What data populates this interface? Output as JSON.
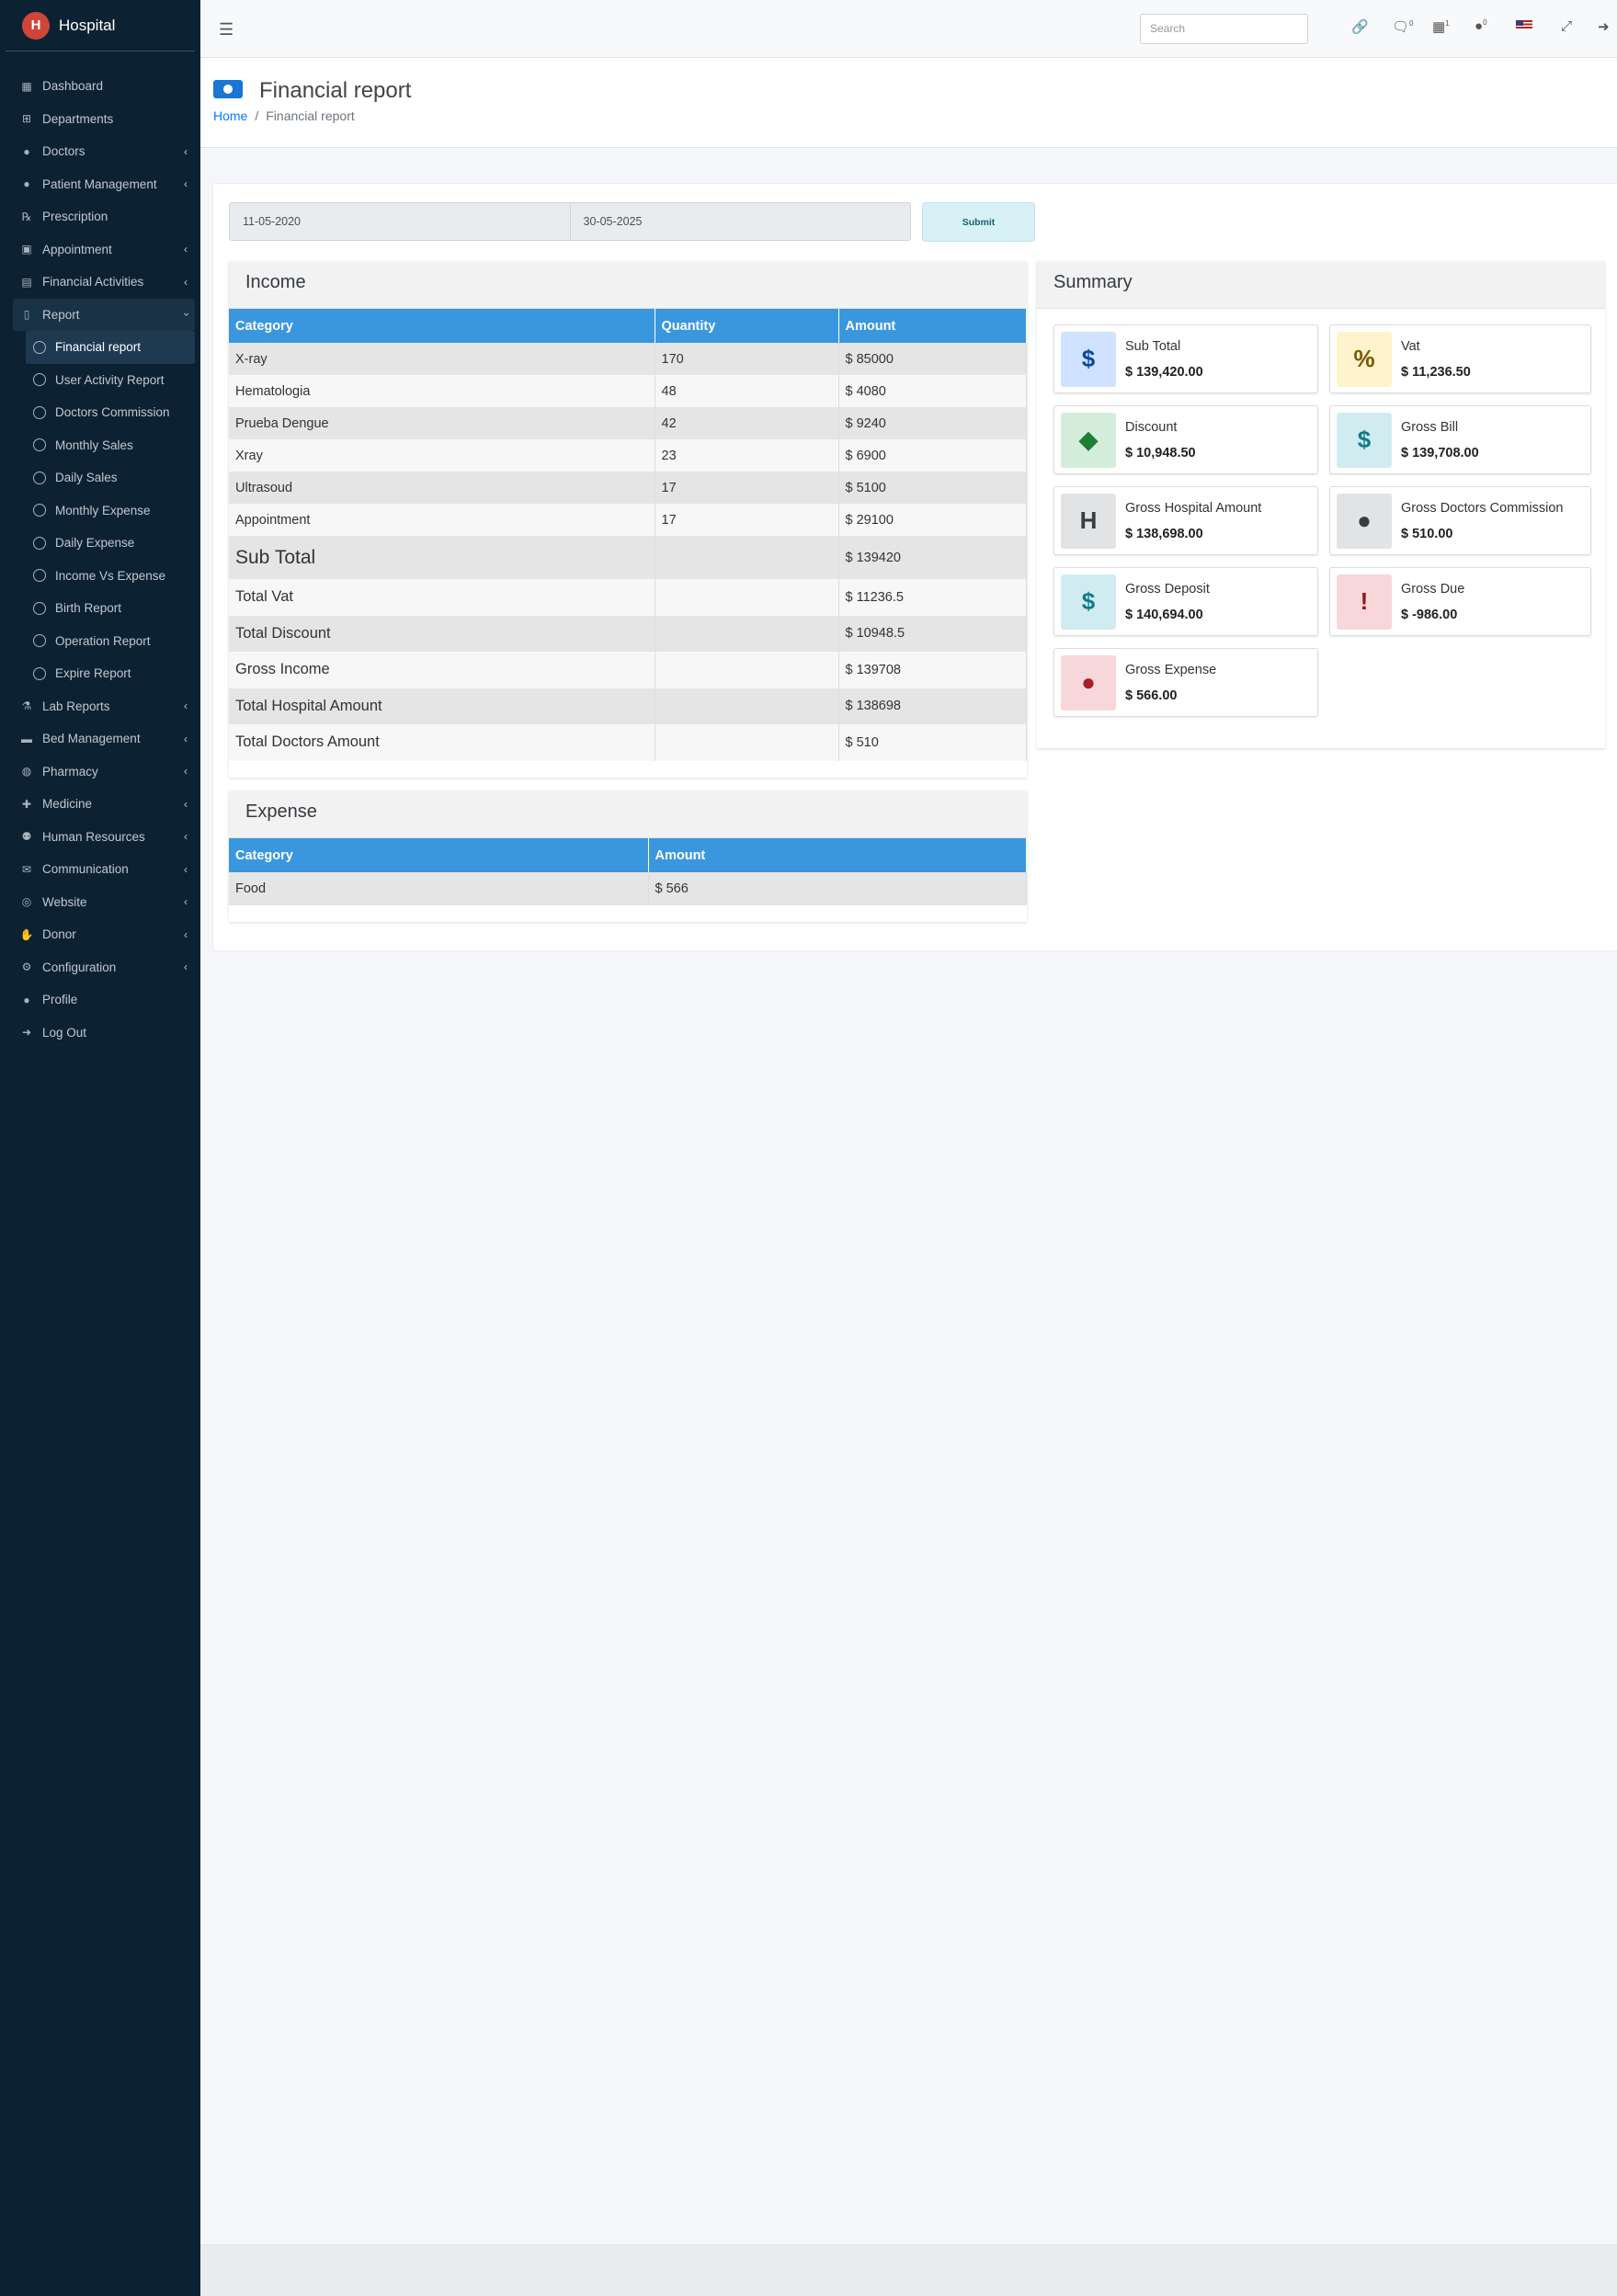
{
  "app": {
    "name": "Hospital",
    "logo": "H"
  },
  "sidebar": {
    "items": [
      {
        "label": "Dashboard",
        "icon": "th-icon"
      },
      {
        "label": "Departments",
        "icon": "sitemap-icon"
      },
      {
        "label": "Doctors",
        "icon": "user-md-icon",
        "chevron": true
      },
      {
        "label": "Patient Management",
        "icon": "user-icon",
        "chevron": true
      },
      {
        "label": "Prescription",
        "icon": "prescription-icon"
      },
      {
        "label": "Appointment",
        "icon": "calendar-check-icon",
        "chevron": true
      },
      {
        "label": "Financial Activities",
        "icon": "money-check-icon",
        "chevron": true
      },
      {
        "label": "Report",
        "icon": "file-icon",
        "chevron": true
      }
    ],
    "report_sub": [
      "Financial report",
      "User Activity Report",
      "Doctors Commission",
      "Monthly Sales",
      "Daily Sales",
      "Monthly Expense",
      "Daily Expense",
      "Income Vs Expense",
      "Birth Report",
      "Operation Report",
      "Expire Report"
    ],
    "items_after": [
      {
        "label": "Lab Reports",
        "icon": "flask-icon",
        "chevron": true
      },
      {
        "label": "Bed Management",
        "icon": "bed-icon",
        "chevron": true
      },
      {
        "label": "Pharmacy",
        "icon": "pills-icon",
        "chevron": true
      },
      {
        "label": "Medicine",
        "icon": "medkit-icon",
        "chevron": true
      },
      {
        "label": "Human Resources",
        "icon": "users-icon",
        "chevron": true
      },
      {
        "label": "Communication",
        "icon": "comments-icon",
        "chevron": true
      },
      {
        "label": "Website",
        "icon": "globe-icon",
        "chevron": true
      },
      {
        "label": "Donor",
        "icon": "hand-holding-icon",
        "chevron": true
      },
      {
        "label": "Configuration",
        "icon": "cogs-icon",
        "chevron": true
      },
      {
        "label": "Profile",
        "icon": "user-icon"
      },
      {
        "label": "Log Out",
        "icon": "sign-out-icon"
      }
    ]
  },
  "topbar": {
    "search_placeholder": "Search",
    "icons": [
      "link-icon",
      "comments-icon",
      "money-icon",
      "user-icon",
      "us-flag-icon",
      "expand-icon",
      "sign-out-icon"
    ],
    "badges": {
      "comments": "0",
      "money": "1",
      "user": "0"
    }
  },
  "header": {
    "title": "Financial report",
    "breadcrumb_home": "Home",
    "breadcrumb_current": "Financial report"
  },
  "filter": {
    "date_from": "11-05-2020",
    "date_to": "30-05-2025",
    "submit_label": "Submit"
  },
  "income": {
    "title": "Income",
    "columns": [
      "Category",
      "Quantity",
      "Amount"
    ],
    "rows": [
      [
        "X-ray",
        "170",
        "$ 85000"
      ],
      [
        "Hematologia",
        "48",
        "$ 4080"
      ],
      [
        "Prueba Dengue",
        "42",
        "$ 9240"
      ],
      [
        "Xray",
        "23",
        "$ 6900"
      ],
      [
        "Ultrasoud",
        "17",
        "$ 5100"
      ],
      [
        "Appointment",
        "17",
        "$ 29100"
      ]
    ],
    "totals": [
      [
        "Sub Total",
        "$ 139420"
      ],
      [
        "Total Vat",
        "$ 11236.5"
      ],
      [
        "Total Discount",
        "$ 10948.5"
      ],
      [
        "Gross Income",
        "$ 139708"
      ],
      [
        "Total Hospital Amount",
        "$ 138698"
      ],
      [
        "Total Doctors Amount",
        "$ 510"
      ]
    ]
  },
  "expense": {
    "title": "Expense",
    "columns": [
      "Category",
      "Amount"
    ],
    "rows": [
      [
        "Food",
        "$ 566"
      ]
    ]
  },
  "summary": {
    "title": "Summary",
    "boxes": [
      {
        "label": "Sub Total",
        "value": "$ 139,420.00",
        "icon": "money-bill-icon",
        "bg": "#cfe2ff",
        "fg": "#0d47a1",
        "glyph": "$"
      },
      {
        "label": "Vat",
        "value": "$ 11,236.50",
        "icon": "percent-icon",
        "bg": "#fff3cd",
        "fg": "#7a5a00",
        "glyph": "%"
      },
      {
        "label": "Discount",
        "value": "$ 10,948.50",
        "icon": "tags-icon",
        "bg": "#d4edda",
        "fg": "#1e7e34",
        "glyph": "◆"
      },
      {
        "label": "Gross Bill",
        "value": "$ 139,708.00",
        "icon": "file-invoice-dollar-icon",
        "bg": "#d1ecf1",
        "fg": "#117a8b",
        "glyph": "$"
      },
      {
        "label": "Gross Hospital Amount",
        "value": "$ 138,698.00",
        "icon": "hospital-icon",
        "bg": "#e2e3e5",
        "fg": "#383d41",
        "glyph": "H"
      },
      {
        "label": "Gross Doctors Commission",
        "value": "$ 510.00",
        "icon": "user-md-icon",
        "bg": "#e2e3e5",
        "fg": "#383d41",
        "glyph": "●"
      },
      {
        "label": "Gross Deposit",
        "value": "$ 140,694.00",
        "icon": "hand-holding-usd-icon",
        "bg": "#d1ecf1",
        "fg": "#117a8b",
        "glyph": "$"
      },
      {
        "label": "Gross Due",
        "value": "$ -986.00",
        "icon": "exclamation-triangle-icon",
        "bg": "#f8d7da",
        "fg": "#8b1a1a",
        "glyph": "!"
      },
      {
        "label": "Gross Expense",
        "value": "$ 566.00",
        "icon": "money-bill-icon",
        "bg": "#f8d7da",
        "fg": "#a71d2a",
        "glyph": "●"
      }
    ]
  },
  "colors": {
    "sidebar": "#0c2233",
    "table_header": "#3a97dd",
    "link": "#007bff"
  }
}
